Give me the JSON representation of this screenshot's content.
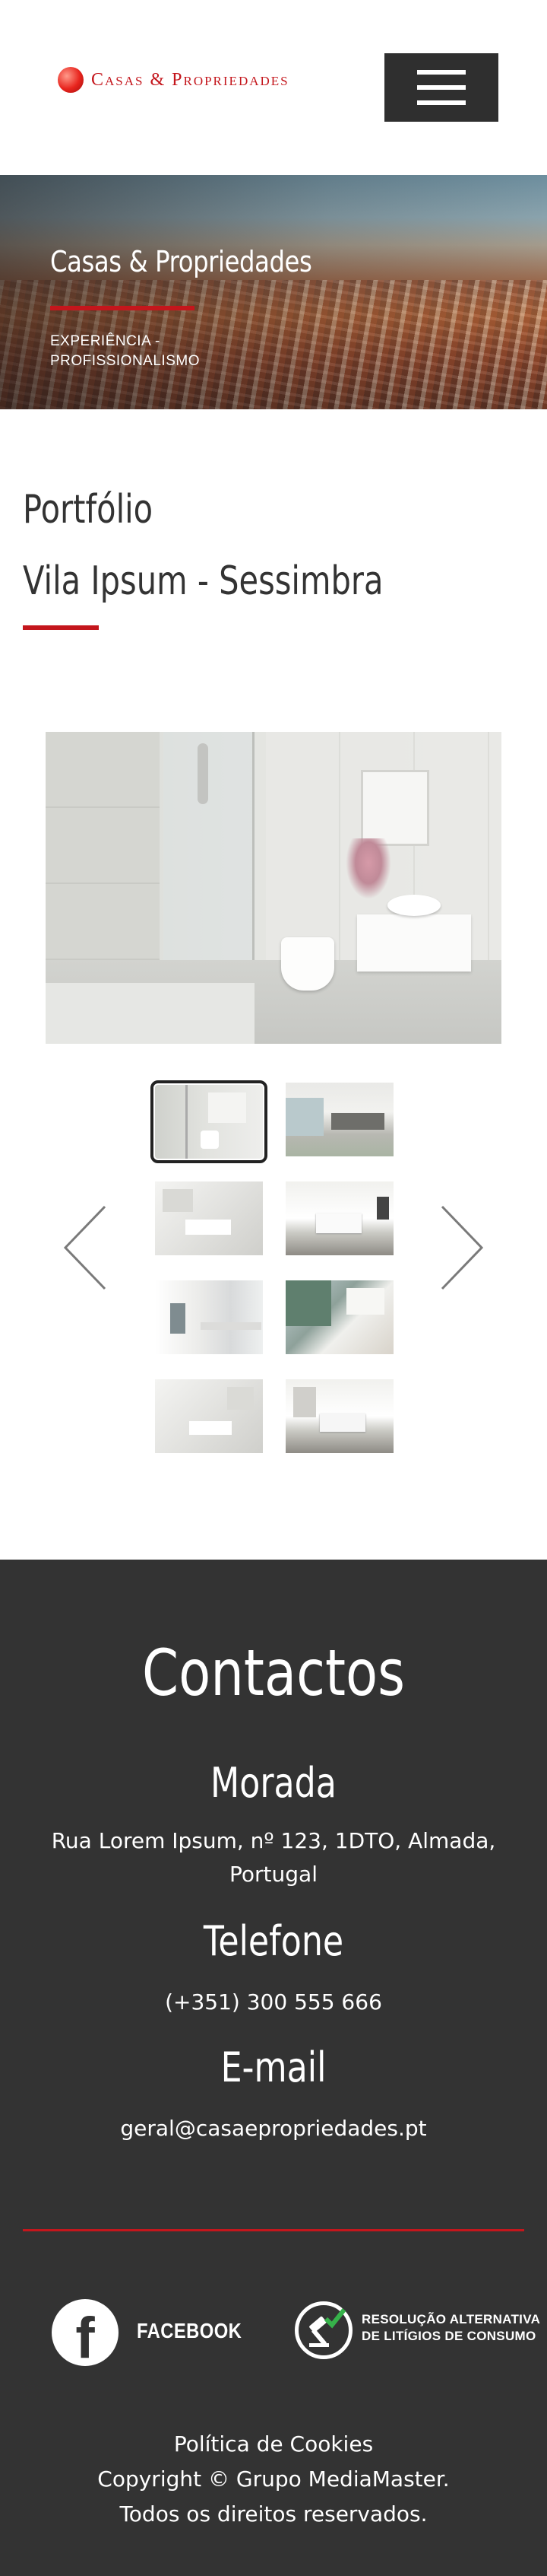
{
  "brand": {
    "name": "Casas & Propriedades",
    "accent_color": "#c4161c",
    "dark_color": "#333333"
  },
  "header": {
    "logo_text": "Casas & Propriedades",
    "menu_icon": "hamburger-icon"
  },
  "hero": {
    "title": "Casas & Propriedades",
    "subtitle_line1": "EXPERIÊNCIA -",
    "subtitle_line2": "PROFISSIONALISMO"
  },
  "portfolio": {
    "label": "Portfólio",
    "project_title": "Vila Ipsum - Sessimbra"
  },
  "gallery": {
    "prev_icon": "chevron-left-icon",
    "next_icon": "chevron-right-icon",
    "active_index": 0,
    "thumb_count": 8
  },
  "footer": {
    "title": "Contactos",
    "address_heading": "Morada",
    "address_text": "Rua Lorem Ipsum, nº 123, 1DTO, Almada, Portugal",
    "phone_heading": "Telefone",
    "phone_text": "(+351) 300 555 666",
    "email_heading": "E-mail",
    "email_text": "geral@casaepropriedades.pt",
    "facebook_label": "FACEBOOK",
    "ral_line1": "RESOLUÇÃO ALTERNATIVA",
    "ral_line2": "DE LITÍGIOS DE CONSUMO",
    "cookies_link": "Política de Cookies",
    "copyright": "Copyright © Grupo MediaMaster.",
    "rights": "Todos os direitos reservados."
  }
}
